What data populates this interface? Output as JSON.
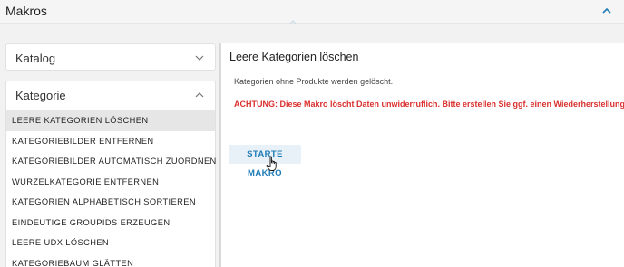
{
  "header": {
    "title": "Makros",
    "collapse_icon": "chevron-up-icon",
    "accent_color": "#1f7bb6"
  },
  "sidebar": {
    "sections": [
      {
        "label": "Katalog",
        "icon": "chevron-down-icon"
      },
      {
        "label": "Kategorie",
        "icon": "chevron-up-icon"
      }
    ],
    "items": [
      {
        "label": "LEERE KATEGORIEN LÖSCHEN"
      },
      {
        "label": "KATEGORIEBILDER ENTFERNEN"
      },
      {
        "label": "KATEGORIEBILDER AUTOMATISCH ZUORDNEN"
      },
      {
        "label": "WURZELKATEGORIE ENTFERNEN"
      },
      {
        "label": "KATEGORIEN ALPHABETISCH SORTIEREN"
      },
      {
        "label": "EINDEUTIGE GROUPIDS ERZEUGEN"
      },
      {
        "label": "LEERE UDX LÖSCHEN"
      },
      {
        "label": "KATEGORIEBAUM GLÄTTEN"
      }
    ],
    "active_index": 0
  },
  "main": {
    "heading": "Leere Kategorien löschen",
    "description": "Kategorien ohne Produkte werden gelöscht.",
    "warning": "ACHTUNG: Diese Makro löscht Daten unwiderruflich. Bitte erstellen Sie ggf. einen Wiederherstellungspunkt.",
    "warning_color": "#d9302e",
    "start_button": "STARTE MAKRO"
  }
}
